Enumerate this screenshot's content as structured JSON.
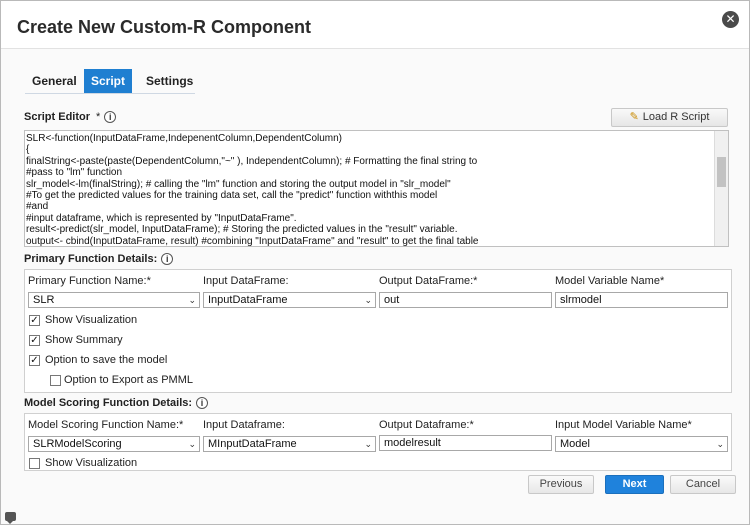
{
  "dialog": {
    "title": "Create New Custom-R Component",
    "close_glyph": "✕"
  },
  "tabs": [
    {
      "label": "General",
      "active": false
    },
    {
      "label": "Script",
      "active": true
    },
    {
      "label": "Settings",
      "active": false
    }
  ],
  "script_editor": {
    "label": "Script Editor",
    "required_mark": "*",
    "load_button_label": "Load R Script",
    "lines": [
      "SLR<-function(InputDataFrame,IndepenentColumn,DependentColumn)",
      "{",
      "finalString<-paste(paste(DependentColumn,\"~\" ), IndependentColumn); # Formatting the final string to",
      "#pass to \"lm\" function",
      "slr_model<-lm(finalString); # calling the \"lm\" function and storing the output model in \"slr_model\"",
      "#To get the predicted values for the training data set, call the \"predict\" function withthis model",
      "#and",
      "#input dataframe, which is represented by \"InputDataFrame\".",
      "result<-predict(slr_model, InputDataFrame); # Storing the predicted values in the \"result\" variable.",
      "output<- cbind(InputDataFrame, result) #combining \"InputDataFrame\" and \"result\" to get the final table"
    ]
  },
  "primary": {
    "section_label": "Primary Function Details:",
    "function_name_label": "Primary Function Name:*",
    "function_name_value": "SLR",
    "input_df_label": "Input DataFrame:",
    "input_df_value": "InputDataFrame",
    "output_df_label": "Output DataFrame:*",
    "output_df_value": "out",
    "model_var_label": "Model Variable Name*",
    "model_var_value": "slrmodel",
    "show_visualization_label": "Show Visualization",
    "show_visualization_checked": true,
    "show_summary_label": "Show Summary",
    "show_summary_checked": true,
    "save_model_label": "Option to save the model",
    "save_model_checked": true,
    "export_pmml_label": "Option to Export as PMML",
    "export_pmml_checked": false
  },
  "scoring": {
    "section_label": "Model Scoring Function Details:",
    "function_name_label": "Model Scoring Function Name:*",
    "function_name_value": "SLRModelScoring",
    "input_df_label": "Input Dataframe:",
    "input_df_value": "MInputDataFrame",
    "output_df_label": "Output Dataframe:*",
    "output_df_value": "modelresult",
    "model_var_label": "Input Model Variable Name*",
    "model_var_value": "Model",
    "show_visualization_label": "Show Visualization",
    "show_visualization_checked": false
  },
  "footer": {
    "previous_label": "Previous",
    "next_label": "Next",
    "cancel_label": "Cancel"
  },
  "glyphs": {
    "info": "i",
    "check": "✓",
    "arrow": "⌄"
  },
  "colors": {
    "accent": "#1f7fd1",
    "primary_button": "#1f82dc"
  }
}
